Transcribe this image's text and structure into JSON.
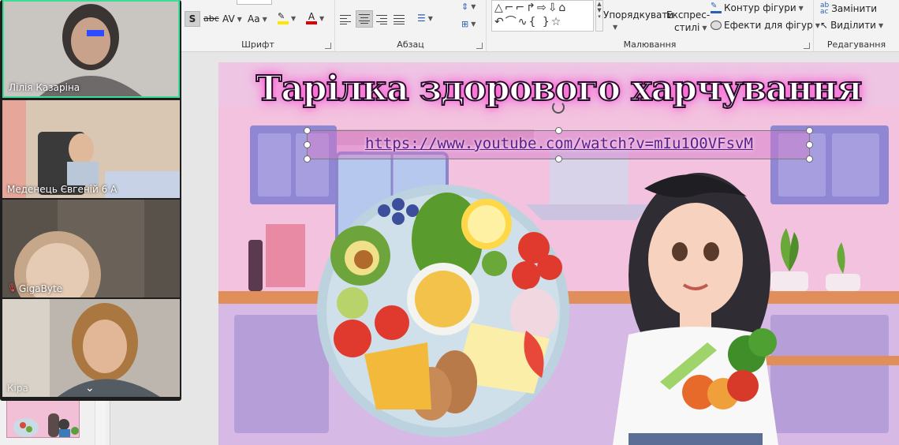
{
  "ribbon": {
    "groups": {
      "font": "Шрифт",
      "paragraph": "Абзац",
      "drawing": "Малювання",
      "editing": "Редагування"
    },
    "font_tools": {
      "strikethrough": "abc",
      "spacing": "AV",
      "case": "Aa"
    },
    "drawing": {
      "arrange": "Упорядкувати",
      "quick_styles_1": "Експрес-",
      "quick_styles_2": "стилі",
      "shape_outline": "Контур фігури",
      "shape_effects": "Ефекти для фігур"
    },
    "editing": {
      "replace": "Замінити",
      "select": "Виділити"
    }
  },
  "slide": {
    "title": "Тарілка здорового харчування",
    "link": "https://www.youtube.com/watch?v=mIu1O0VFsvM"
  },
  "call": {
    "participants": [
      {
        "name": "Лілія Казаріна",
        "muted": false
      },
      {
        "name": "Меденець Євгеній 6 А",
        "muted": false
      },
      {
        "name": "GigaByte",
        "muted": true
      },
      {
        "name": "Кіра",
        "muted": false
      }
    ]
  },
  "colors": {
    "active_speaker": "#3ddc97",
    "title_fill": "#ffffff",
    "title_stroke": "#2a0a2a",
    "link_color": "#5a1e8a"
  }
}
